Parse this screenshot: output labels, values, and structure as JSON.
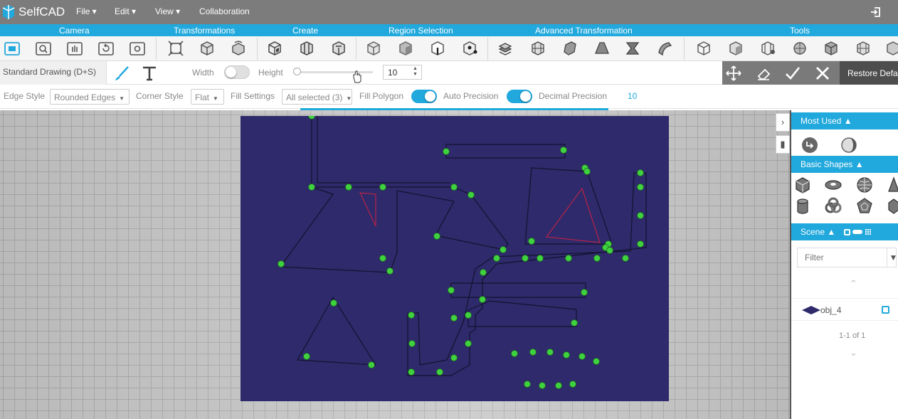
{
  "app": {
    "name": "SelfCAD"
  },
  "menu": {
    "file": "File",
    "edit": "Edit",
    "view": "View",
    "collaboration": "Collaboration"
  },
  "categories": {
    "camera": "Camera",
    "transformations": "Transformations",
    "create": "Create",
    "region_selection": "Region Selection",
    "advanced_transformation": "Advanced Transformation",
    "tools": "Tools"
  },
  "drawing": {
    "mode_label": "Standard Drawing (D+S)",
    "width_label": "Width",
    "height_label": "Height",
    "height_value": "10",
    "width_toggle": false,
    "height_slider_level": 0.0
  },
  "actions": {
    "restore_label": "Restore Defaults"
  },
  "settings": {
    "edge_style_label": "Edge Style",
    "edge_style_value": "Rounded Edges",
    "corner_style_label": "Corner Style",
    "corner_style_value": "Flat",
    "fill_settings_label": "Fill Settings",
    "fill_settings_value": "All selected (3)",
    "fill_polygon_label": "Fill Polygon",
    "fill_polygon_on": true,
    "auto_precision_label": "Auto Precision",
    "auto_precision_on": true,
    "decimal_precision_label": "Decimal Precision",
    "decimal_precision_value": "10"
  },
  "panel": {
    "most_used_label": "Most Used",
    "basic_shapes_label": "Basic Shapes",
    "scene_label": "Scene",
    "filter_placeholder": "Filter",
    "object_name": "obj_4",
    "pagination": "1-1 of 1"
  },
  "colors": {
    "accent": "#21a8dc",
    "topbar": "#7c7c7c",
    "sketch_fill": "#2e2a6b",
    "sketch_point": "#3fd13f",
    "sketch_highlight": "#b0234a"
  }
}
